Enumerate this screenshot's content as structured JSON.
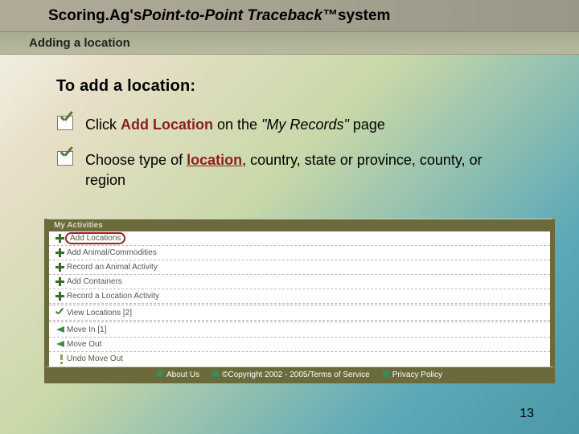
{
  "title": {
    "prefix": "Scoring.Ag's ",
    "main": "Point-to-Point Traceback™ ",
    "suffix": "system"
  },
  "subtitle": "Adding a location",
  "heading": "To add a location:",
  "bullets": [
    {
      "pre": "Click ",
      "red": "Add Location",
      "mid": "  on the ",
      "ital": "\"My Records\" ",
      "post": "page"
    },
    {
      "pre": "Choose type of ",
      "redU": "location",
      "post": ", country, state or province, county, or region"
    }
  ],
  "panel": {
    "header": "My Activities",
    "rows": [
      {
        "icon": "plus",
        "circled": true,
        "label": "Add Locations"
      },
      {
        "icon": "plus",
        "label": "Add Animal/Commodities"
      },
      {
        "icon": "plus",
        "label": "Record an Animal Activity"
      },
      {
        "icon": "plus",
        "label": "Add Containers"
      },
      {
        "icon": "plus",
        "label": "Record a Location Activity"
      },
      {
        "icon": "check",
        "label": "View Locations [2]"
      },
      {
        "icon": "arrow",
        "label": "Move In [1]"
      },
      {
        "icon": "arrow",
        "label": "Move Out"
      },
      {
        "icon": "excl",
        "label": "Undo Move Out"
      }
    ]
  },
  "footer": {
    "about": "About Us",
    "copy": "©Copyright 2002 - 2005/Terms of Service",
    "privacy": "Privacy Policy"
  },
  "pageNumber": "13"
}
